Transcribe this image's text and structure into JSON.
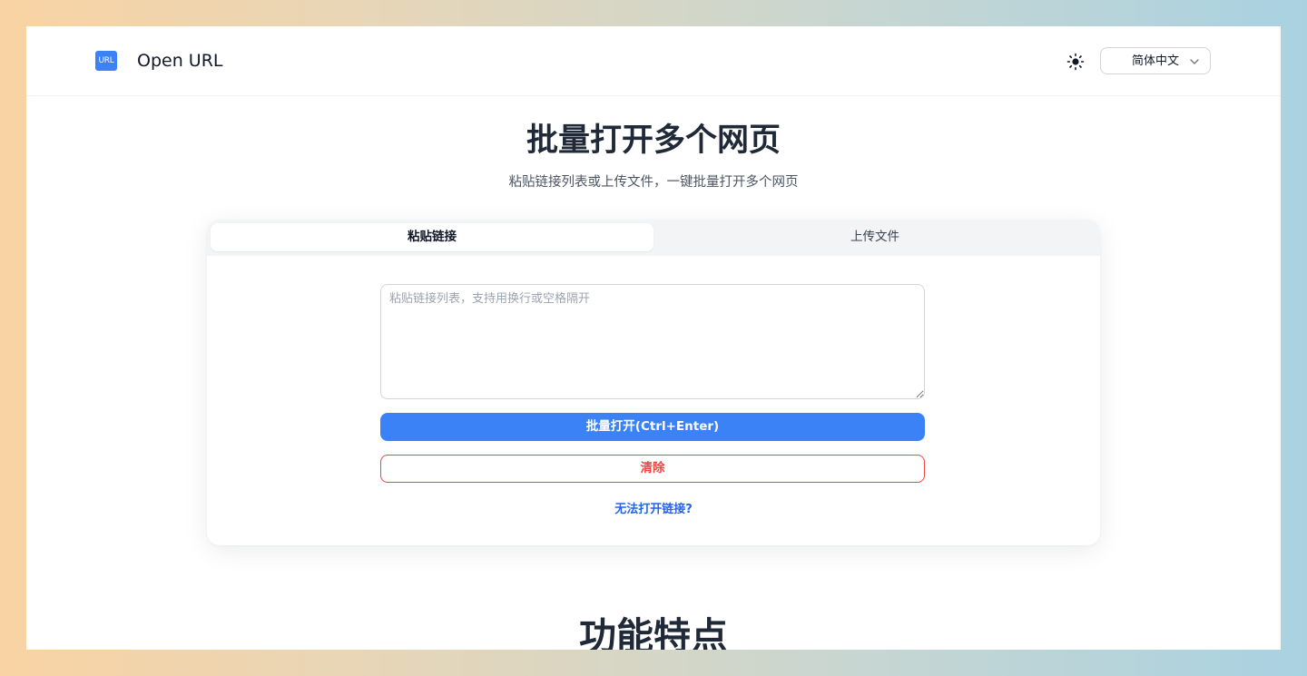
{
  "header": {
    "logo_text": "URL",
    "title": "Open URL",
    "theme_icon": "sun-icon",
    "language": {
      "selected": "简体中文",
      "chevron_icon": "chevron-down-icon"
    }
  },
  "hero": {
    "title": "批量打开多个网页",
    "subtitle": "粘贴链接列表或上传文件，一键批量打开多个网页"
  },
  "card": {
    "tabs": [
      {
        "label": "粘贴链接",
        "active": true
      },
      {
        "label": "上传文件",
        "active": false
      }
    ],
    "textarea": {
      "value": "",
      "placeholder": "粘贴链接列表，支持用换行或空格隔开"
    },
    "open_button_label": "批量打开(Ctrl+Enter)",
    "clear_button_label": "清除",
    "help_link_label": "无法打开链接?"
  },
  "features": {
    "title": "功能特点"
  },
  "colors": {
    "primary": "#3b82f6",
    "danger": "#ef4444",
    "link": "#2563eb"
  }
}
